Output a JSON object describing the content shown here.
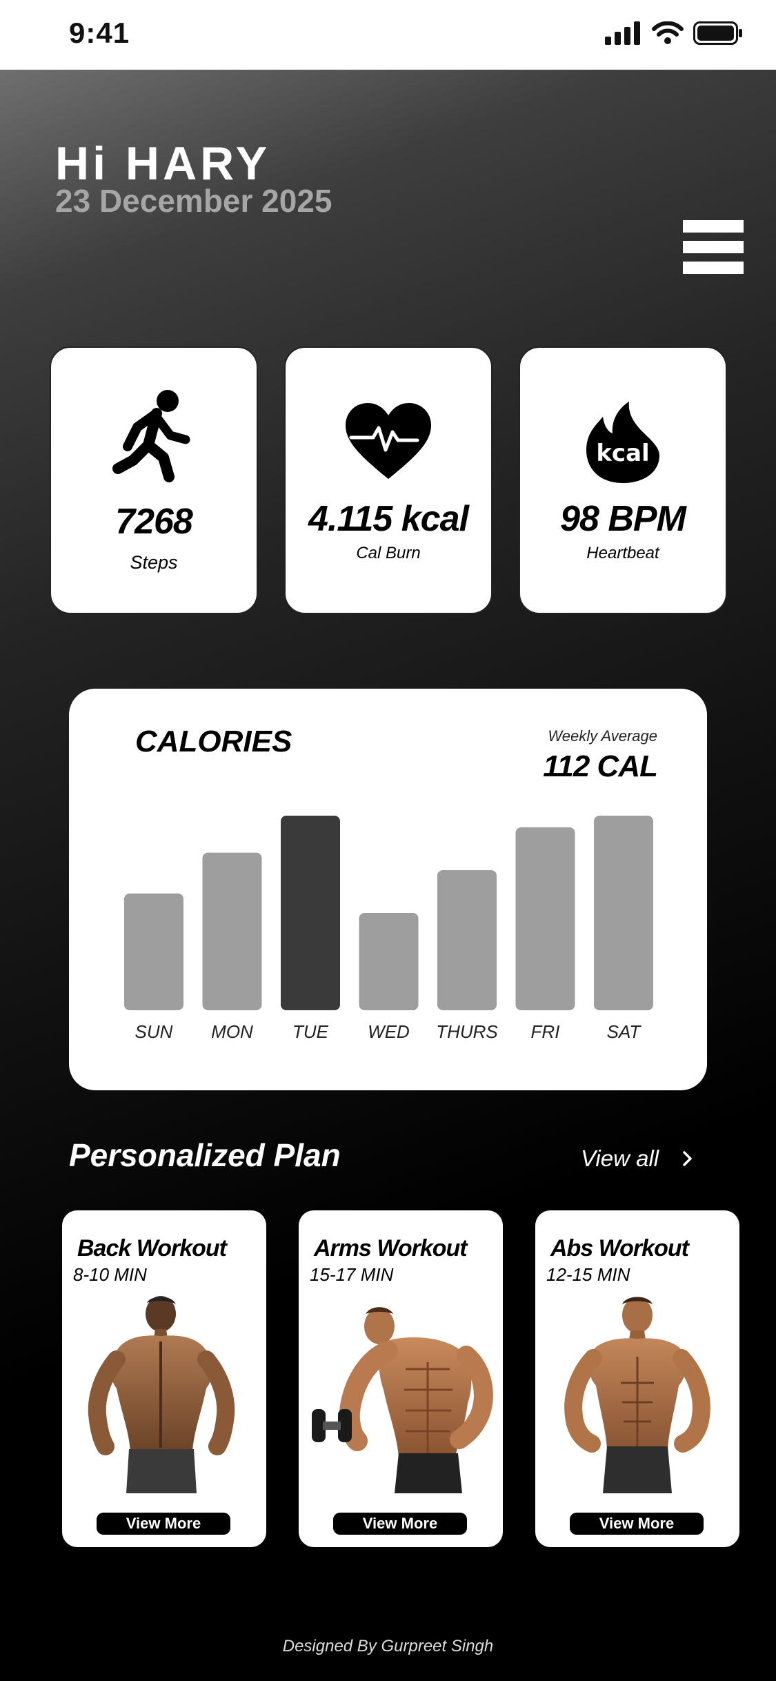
{
  "status_bar": {
    "time": "9:41"
  },
  "header": {
    "greeting": "Hi HARY",
    "date": "23 December 2025"
  },
  "stats": [
    {
      "icon": "running-person-icon",
      "value": "7268",
      "label": "Steps"
    },
    {
      "icon": "heart-pulse-icon",
      "value": "4.115 kcal",
      "label": "Cal Burn"
    },
    {
      "icon": "flame-kcal-icon",
      "value": "98 BPM",
      "label": "Heartbeat",
      "badge": "kcal"
    }
  ],
  "calories": {
    "title": "CALORIES",
    "average_label": "Weekly Average",
    "average_value": "112 CAL"
  },
  "chart_data": {
    "type": "bar",
    "categories": [
      "SUN",
      "MON",
      "TUE",
      "WED",
      "THURS",
      "FRI",
      "SAT"
    ],
    "values": [
      60,
      81,
      100,
      50,
      72,
      94,
      100
    ],
    "ylim": [
      0,
      100
    ],
    "highlight_index": 2,
    "grid": false,
    "colors": {
      "bar": "#9e9e9e",
      "highlight": "#3a3a3a"
    }
  },
  "plan": {
    "title": "Personalized Plan",
    "view_all": "View all",
    "items": [
      {
        "title": "Back Workout",
        "duration": "8-10 MIN",
        "button": "View More"
      },
      {
        "title": "Arms Workout",
        "duration": "15-17 MIN",
        "button": "View More"
      },
      {
        "title": "Abs Workout",
        "duration": "12-15 MIN",
        "button": "View More"
      }
    ]
  },
  "footer": {
    "credit": "Designed By Gurpreet Singh"
  }
}
